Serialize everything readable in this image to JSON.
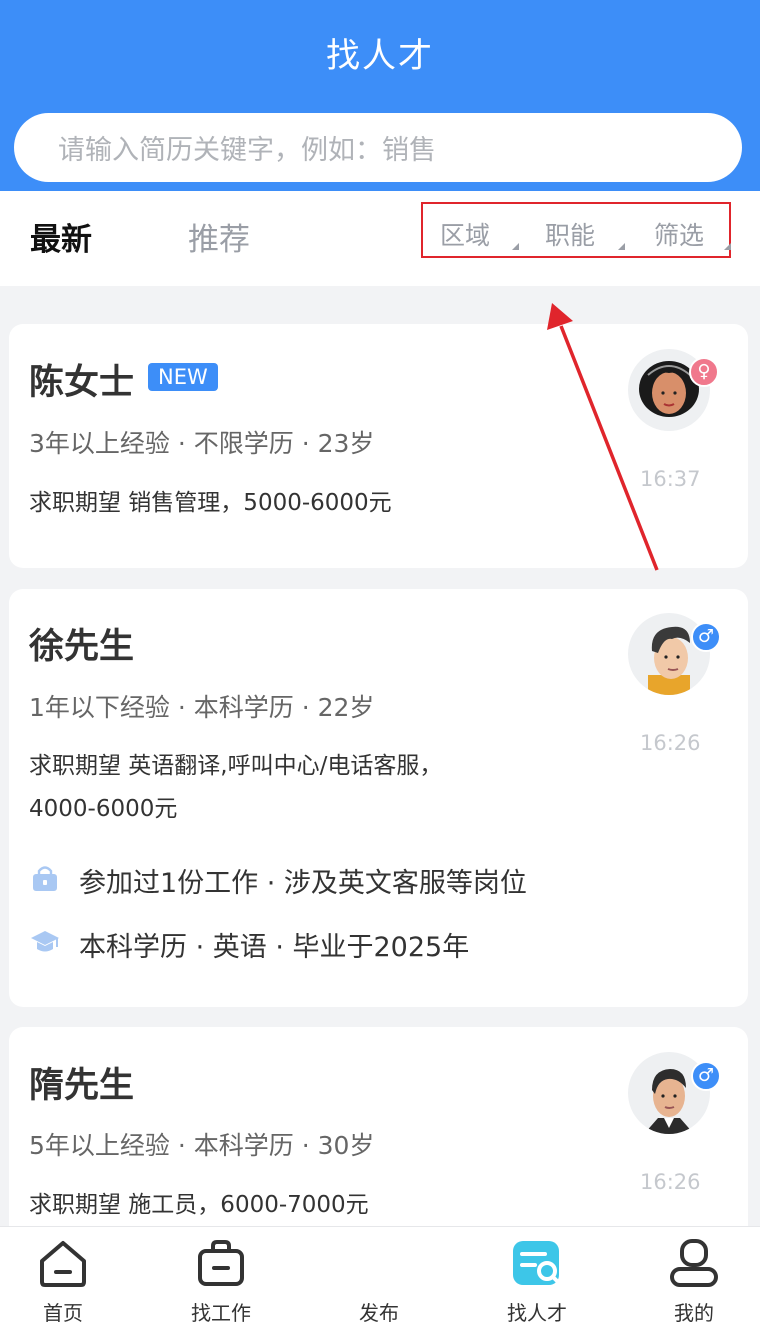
{
  "header": {
    "title": "找人才"
  },
  "search": {
    "placeholder": "请输入简历关键字，例如：销售"
  },
  "tabs": {
    "latest": "最新",
    "recommend": "推荐"
  },
  "filters": {
    "area": "区域",
    "function": "职能",
    "screen": "筛选"
  },
  "candidates": [
    {
      "name": "陈女士",
      "badge": "NEW",
      "meta": "3年以上经验 · 不限学历 · 23岁",
      "expect": "求职期望 销售管理，5000-6000元",
      "time": "16:37",
      "gender": "female"
    },
    {
      "name": "徐先生",
      "meta": "1年以下经验 · 本科学历 · 22岁",
      "expect_line1": "求职期望 英语翻译,呼叫中心/电话客服，",
      "expect_line2": "4000-6000元",
      "work": "参加过1份工作 · 涉及英文客服等岗位",
      "education": "本科学历 · 英语 · 毕业于2025年",
      "time": "16:26",
      "gender": "male"
    },
    {
      "name": "隋先生",
      "meta": "5年以上经验 · 本科学历 · 30岁",
      "expect": "求职期望 施工员，6000-7000元",
      "time": "16:26",
      "gender": "male"
    }
  ],
  "tabbar": {
    "home": "首页",
    "find_job": "找工作",
    "publish": "发布",
    "find_talent": "找人才",
    "mine": "我的"
  },
  "colors": {
    "primary": "#3d8ef8",
    "highlight": "#e0252c",
    "female": "#f0788c"
  },
  "icons": [
    "search-icon",
    "home-icon",
    "briefcase-icon",
    "talent-search-icon",
    "user-icon",
    "lock-bag-icon",
    "graduation-cap-icon",
    "female-icon",
    "male-icon"
  ]
}
